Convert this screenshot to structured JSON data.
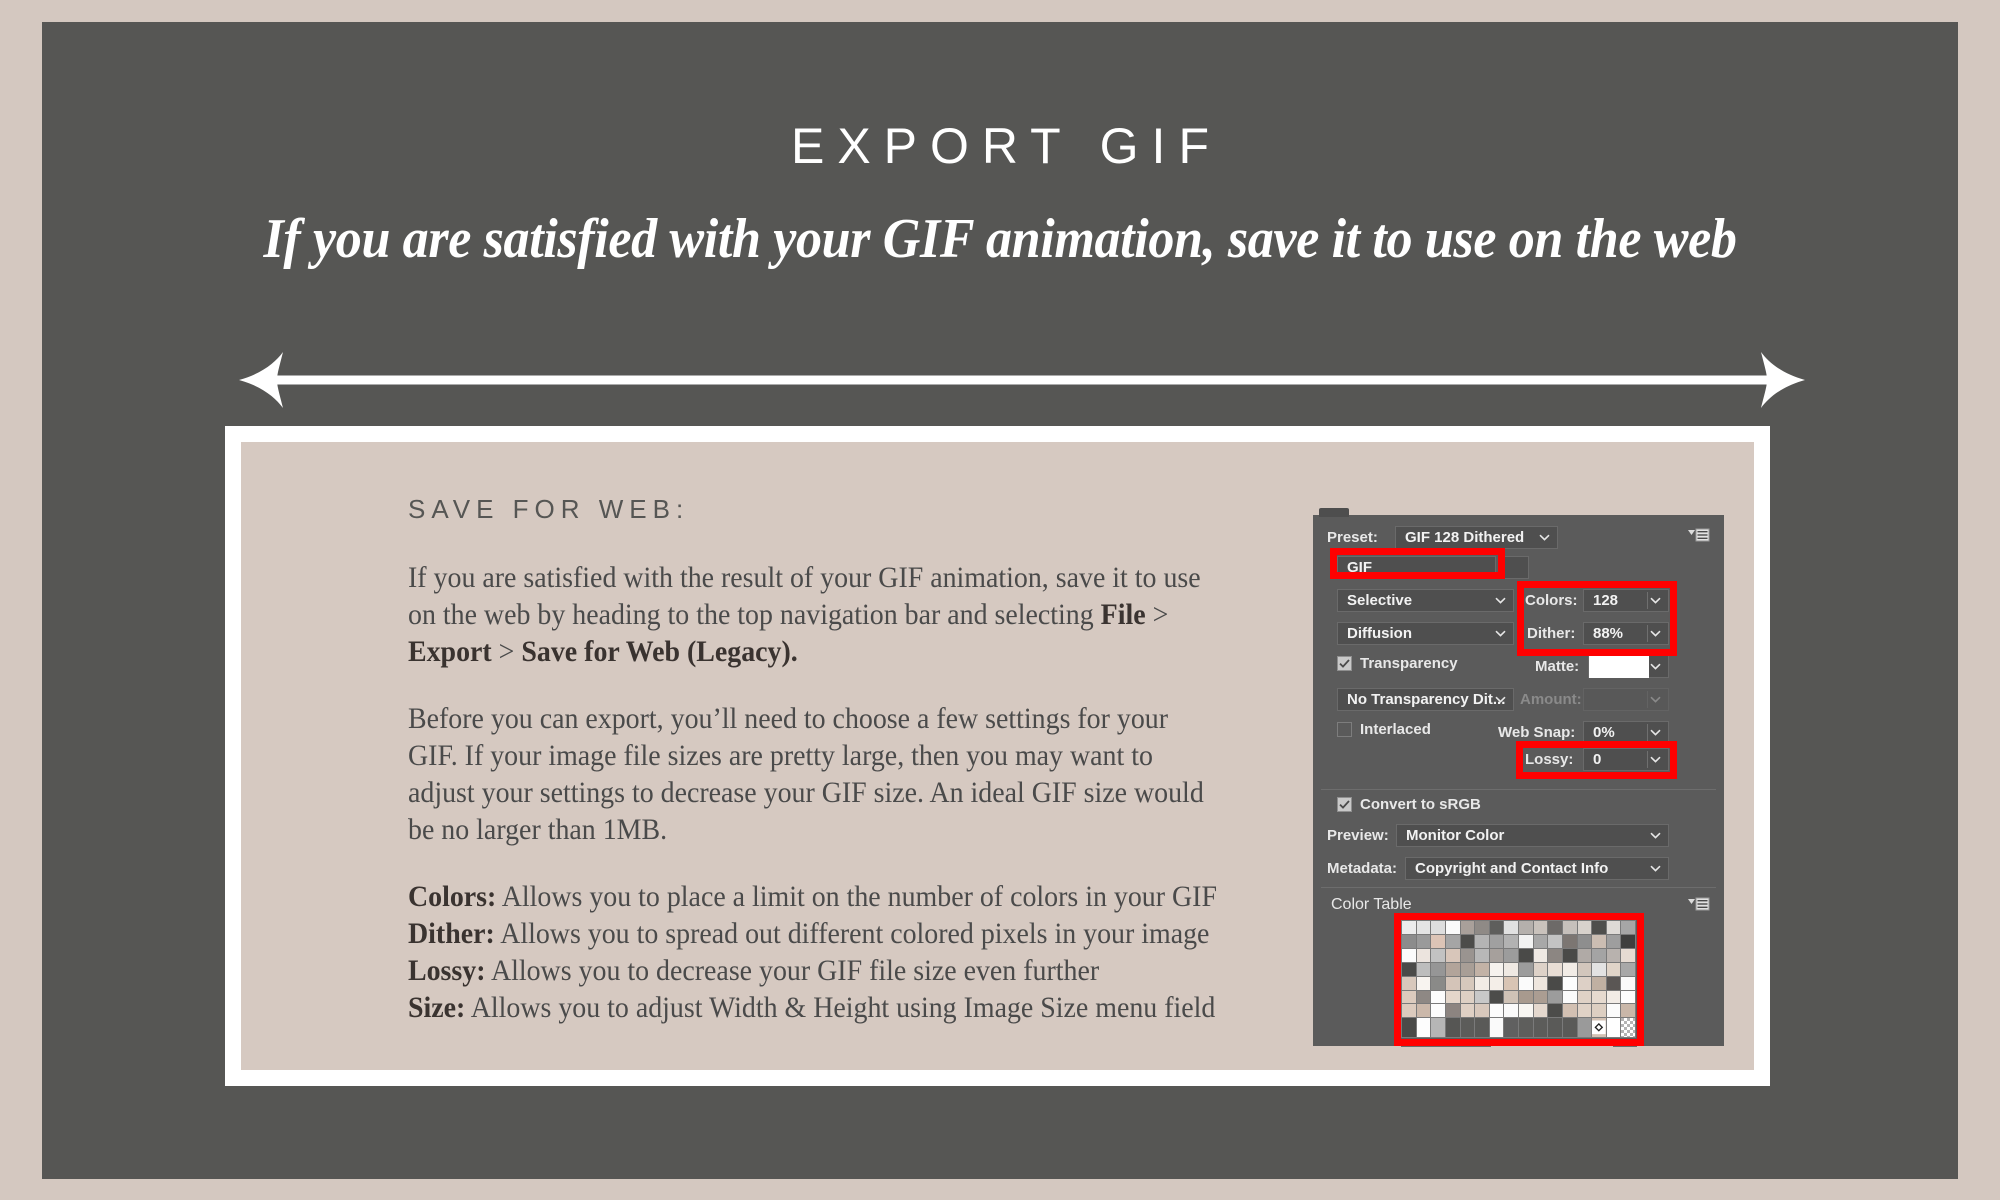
{
  "slide": {
    "title": "EXPORT GIF",
    "subtitle": "If you are satisfied with your GIF animation, save it to use on the web",
    "background_color": "#565654",
    "page_color": "#d4c8c0",
    "card_color": "#d6c9c1",
    "accent_color": "#ff0000"
  },
  "content": {
    "kicker": "SAVE FOR WEB:",
    "paragraph1": {
      "part1": "If you are satisfied with the result of your GIF animation, save it to use on the web by heading to the top navigation bar and selecting ",
      "bold1": "File",
      "part2": " > ",
      "bold2": "Export",
      "part3": " > ",
      "bold3": "Save for Web (Legacy)."
    },
    "paragraph2": "Before you can export, you’ll need to choose a few settings for your GIF. If your image file sizes are pretty large, then you may want to adjust your settings to decrease your GIF size. An ideal GIF size would be no larger than 1MB.",
    "definitions": [
      {
        "term": "Colors:",
        "desc": " Allows you to place a limit on the number of colors in your GIF"
      },
      {
        "term": "Dither:",
        "desc": " Allows you to spread out different colored pixels in your image"
      },
      {
        "term": "Lossy:",
        "desc": " Allows you to decrease your GIF file size even further"
      },
      {
        "term": "Size:",
        "desc": " Allows you to adjust Width & Height using Image Size menu field"
      }
    ]
  },
  "panel": {
    "preset_label": "Preset:",
    "preset_value": "GIF 128 Dithered",
    "format_value": "GIF",
    "reduction_value": "Selective",
    "dither_algorithm_value": "Diffusion",
    "colors_label": "Colors:",
    "colors_value": "128",
    "dither_label": "Dither:",
    "dither_value": "88%",
    "transparency_label": "Transparency",
    "transparency_checked": true,
    "matte_label": "Matte:",
    "matte_value": "",
    "transparency_dither_value": "No Transparency Dit...",
    "amount_label": "Amount:",
    "amount_value": "",
    "interlaced_label": "Interlaced",
    "interlaced_checked": false,
    "websnap_label": "Web Snap:",
    "websnap_value": "0%",
    "lossy_label": "Lossy:",
    "lossy_value": "0",
    "convert_srgb_label": "Convert to sRGB",
    "convert_srgb_checked": true,
    "preview_label": "Preview:",
    "preview_value": "Monitor Color",
    "metadata_label": "Metadata:",
    "metadata_value": "Copyright and Contact Info",
    "color_table_label": "Color Table",
    "color_table_swatches": [
      "#ececec",
      "#e4e4e4",
      "#dedede",
      "#fafafa",
      "#a9a09a",
      "#8f8a86",
      "#5e5e5c",
      "#e1e1e1",
      "#b5b0ac",
      "#c9c2bc",
      "#6d6a68",
      "#c6c0bb",
      "#d8d2cc",
      "#4e4e4c",
      "#dedad6",
      "#a6a6a6",
      "#8c8c8c",
      "#9a9a9a",
      "#dcc4b6",
      "#a5a5a5",
      "#4c4c4a",
      "#b4b4b4",
      "#a0a0a0",
      "#b2b2b2",
      "#f2f2f2",
      "#a8a8a8",
      "#c3c3c3",
      "#7c7672",
      "#8e8e8e",
      "#cbbdb2",
      "#9e9e9e",
      "#3f3f3e",
      "#fbfbfb",
      "#ece4de",
      "#c2c2c2",
      "#d8c6ba",
      "#9a9490",
      "#b8b8b8",
      "#a6a09c",
      "#9c9c9c",
      "#4a4a48",
      "#efe9e3",
      "#8c8682",
      "#4a4a48",
      "#b0aaa6",
      "#a4a4a4",
      "#b8b2ae",
      "#e6dbd2",
      "#4a4a48",
      "#bdbdbd",
      "#969696",
      "#b2a49a",
      "#a89e96",
      "#c2b2a6",
      "#f6f2ee",
      "#efe9e3",
      "#9c9c9c",
      "#ded2c8",
      "#e8ddd4",
      "#f2ece6",
      "#d2c6bc",
      "#e2e2e2",
      "#e0d4c8",
      "#a8a8a8",
      "#d8c8bc",
      "#f8f4f0",
      "#8a8a88",
      "#d4c4b8",
      "#d6c8bc",
      "#f2ece6",
      "#f4eee8",
      "#d8c4b4",
      "#fbfbfb",
      "#eee6de",
      "#4a4a48",
      "#fdfdfd",
      "#ddd0c6",
      "#c0b0a2",
      "#5a5654",
      "#fafafa",
      "#dccbbe",
      "#8e8884",
      "#fcfcfc",
      "#e4d6ca",
      "#ded0c4",
      "#c8c8c8",
      "#4c4c4a",
      "#cfc2b6",
      "#a89a8e",
      "#ab9d92",
      "#9c9c9c",
      "#fbfbfb",
      "#e0d2c6",
      "#e6dacf",
      "#f2ece6",
      "#fdfdfd",
      "#dccbbe",
      "#cbb8aa",
      "#fcfcfc",
      "#8c8480",
      "#dfd0c4",
      "#d8c8bc",
      "#fcfcfc",
      "#fafafa",
      "#f8f6f2",
      "#e4d8ce",
      "#4c4c4a",
      "#d2c0b2",
      "#e0d2c6",
      "#ddcfc2",
      "#fbfbfb",
      "#c9b7a9",
      "#4a4a48",
      "#fdfdfd",
      "#b6b6b6",
      "#565654",
      "#5c5c5a",
      "#5a5a58",
      "#fafafa",
      "#606060",
      "#5e5e5c",
      "#5c5c5a",
      "#5a5a58",
      "#5a5a58",
      "#9a9a9a",
      "#d3c2b4",
      "#ffffff",
      "#616161"
    ]
  },
  "icons": {
    "panel_menu": "hamburger-menu-icon",
    "dropdown": "chevron-down-icon",
    "checkbox_check": "checkmark-icon",
    "arrow": "double-headed-arrow-icon"
  }
}
